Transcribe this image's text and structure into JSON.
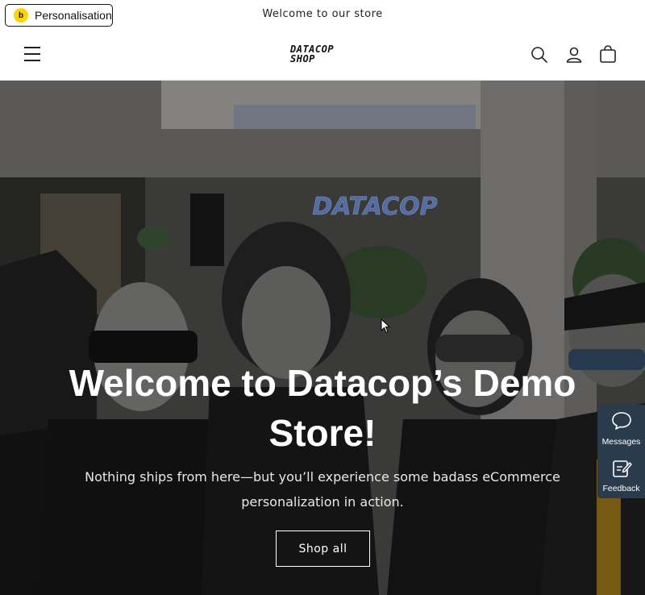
{
  "announcement": {
    "text": "Welcome to our store"
  },
  "personalisation": {
    "label": "Personalisation",
    "badge": "b"
  },
  "header": {
    "logo_line1": "DATACOP",
    "logo_line2": "SHOP",
    "icons": [
      "menu-icon",
      "search-icon",
      "account-icon",
      "cart-icon"
    ]
  },
  "hero": {
    "sign_text": "DATACOP",
    "title": "Welcome to Datacop’s Demo Store!",
    "subtitle": "Nothing ships from here—but you’ll experience some badass eCommerce personalization in action.",
    "button": "Shop all"
  },
  "side_widget": {
    "messages_label": "Messages",
    "feedback_label": "Feedback"
  },
  "colors": {
    "badge_yellow": "#ffd400",
    "widget_bg": "#2a3b4e",
    "neon_sign": "#7fa8ff"
  }
}
